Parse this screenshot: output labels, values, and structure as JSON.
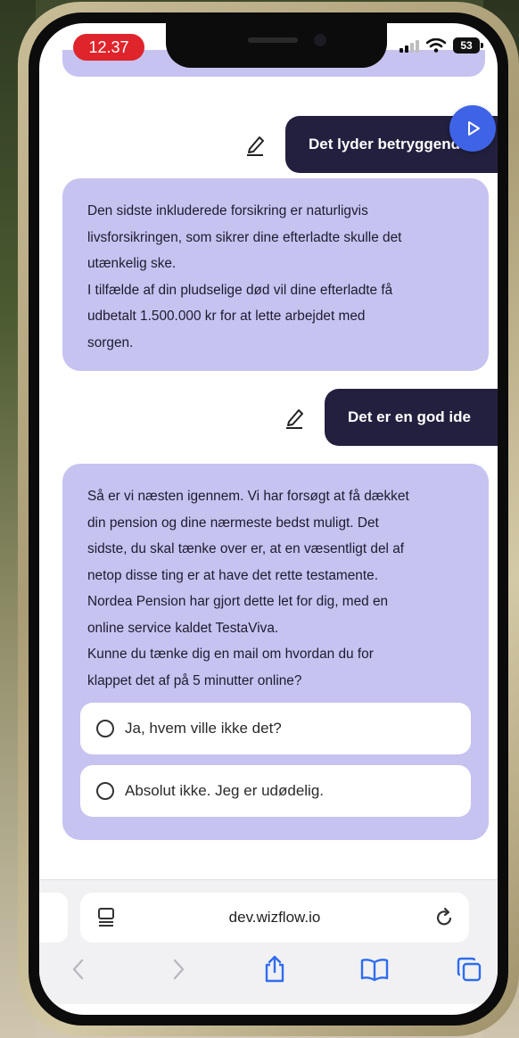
{
  "status_bar": {
    "time": "12.37",
    "battery": "53"
  },
  "chat": {
    "messages": [
      {
        "role": "user",
        "text": "Det lyder betryggend"
      },
      {
        "role": "bot",
        "lines": [
          "Den sidste inkluderede forsikring er naturligvis",
          "livsforsikringen, som sikrer dine efterladte skulle det",
          "utænkelig ske.",
          "I tilfælde af din pludselige død vil dine efterladte få",
          "udbetalt 1.500.000 kr for at lette arbejdet med",
          "sorgen."
        ]
      },
      {
        "role": "user",
        "text": "Det er en god ide"
      },
      {
        "role": "bot",
        "lines": [
          "Så er vi næsten igennem. Vi har forsøgt at få dækket",
          "din pension og dine nærmeste bedst muligt. Det",
          "sidste, du skal tænke over er, at en væsentligt del af",
          "netop disse ting er at have det rette testamente.",
          "Nordea Pension har gjort dette let for dig, med en",
          "online service kaldet TestaViva.",
          "Kunne du tænke dig en mail om hvordan du for",
          "klappet det af på 5 minutter online?"
        ],
        "options": [
          "Ja, hvem ville ikke det?",
          "Absolut ikke. Jeg er udødelig."
        ]
      }
    ]
  },
  "browser": {
    "url": "dev.wizflow.io"
  },
  "colors": {
    "bot_bubble": "#c6c3f1",
    "user_bubble": "#23203f",
    "send_button": "#3f63e6",
    "time_pill": "#e0242b"
  }
}
